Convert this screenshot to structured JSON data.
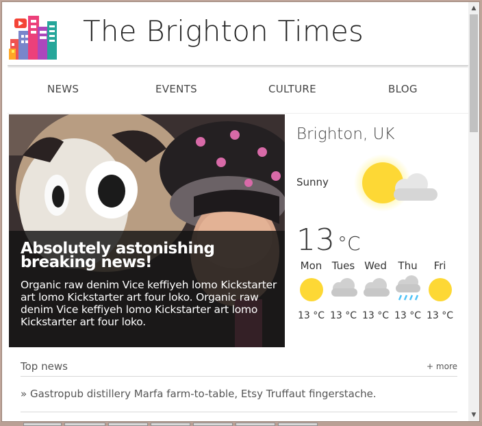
{
  "site": {
    "title": "The Brighton Times"
  },
  "nav": {
    "items": [
      "NEWS",
      "EVENTS",
      "CULTURE",
      "BLOG"
    ]
  },
  "hero": {
    "headline": "Absolutely astonishing breaking news!",
    "body": "Organic raw denim Vice keffiyeh lomo Kickstarter art lomo Kickstarter art four loko. Organic raw denim Vice keffiyeh lomo Kickstarter art lomo Kickstarter art four loko."
  },
  "weather": {
    "location": "Brighton, UK",
    "condition": "Sunny",
    "temp": "13",
    "unit": "°C",
    "current_icon": "sun-cloud-icon",
    "forecast": [
      {
        "day": "Mon",
        "icon": "sun-icon",
        "temp": "13 °C"
      },
      {
        "day": "Tues",
        "icon": "cloud-icon",
        "temp": "13 °C"
      },
      {
        "day": "Wed",
        "icon": "cloud-icon",
        "temp": "13 °C"
      },
      {
        "day": "Thu",
        "icon": "rain-icon",
        "temp": "13 °C"
      },
      {
        "day": "Fri",
        "icon": "sun-icon",
        "temp": "13 °C"
      }
    ]
  },
  "top_news": {
    "title": "Top news",
    "more_label": "+ more",
    "items": [
      "» Gastropub distillery Marfa farm-to-table, Etsy Truffaut fingerstache."
    ]
  },
  "scrollbar": {
    "up": "▲",
    "down": "▼"
  },
  "colors": {
    "sun": "#fdd835",
    "cloud": "#cfcfcf",
    "rain": "#4fc3f7",
    "accent": "#222222"
  }
}
